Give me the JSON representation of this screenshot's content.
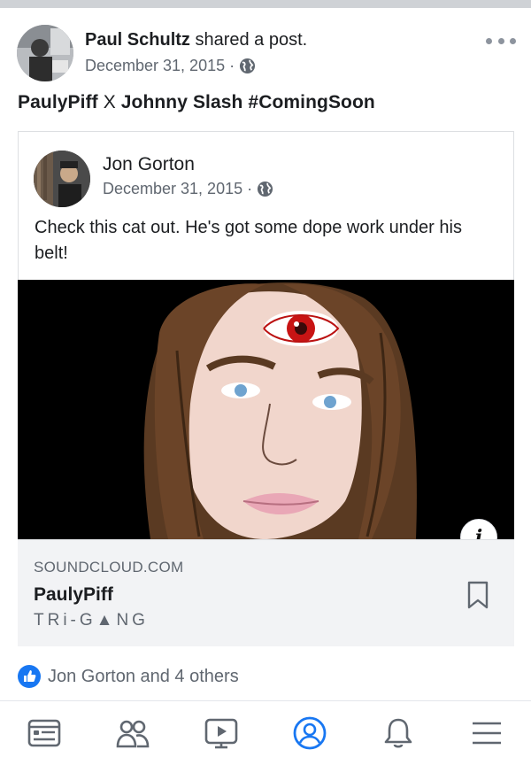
{
  "post": {
    "author": "Paul Schultz",
    "action": "shared a post.",
    "date": "December 31, 2015",
    "separator": "·",
    "privacy_icon": "globe-icon",
    "text_bold_1": "PaulyPiff",
    "text_plain": " X ",
    "text_bold_2": "Johnny Slash #ComingSoon"
  },
  "shared": {
    "author": "Jon Gorton",
    "date": "December 31, 2015",
    "separator": "·",
    "privacy_icon": "globe-icon",
    "text": "Check this cat out. He's got some dope work under his belt!",
    "link": {
      "domain": "SOUNDCLOUD.COM",
      "title": "PaulyPiff",
      "subtitle": "TRi-G▲NG"
    },
    "info_label": "i"
  },
  "reactions": {
    "icon": "like-icon",
    "text": "Jon Gorton and 4 others"
  },
  "nav": [
    {
      "name": "news-feed-icon"
    },
    {
      "name": "friends-icon"
    },
    {
      "name": "watch-icon"
    },
    {
      "name": "profile-icon",
      "active": true
    },
    {
      "name": "notifications-icon"
    },
    {
      "name": "menu-icon"
    }
  ],
  "colors": {
    "accent": "#1877f2",
    "secondary_text": "#606770",
    "card_footer": "#f2f3f5"
  }
}
